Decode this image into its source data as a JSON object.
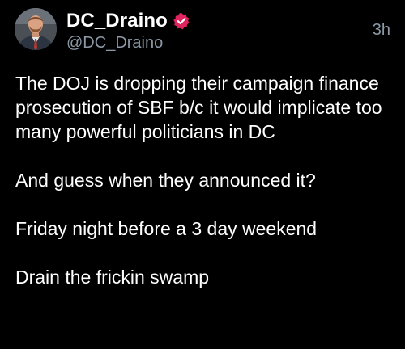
{
  "post": {
    "display_name": "DC_Draino",
    "handle": "@DC_Draino",
    "timestamp": "3h",
    "verified_color": "#e0245e",
    "paragraphs": [
      "The DOJ is dropping their campaign finance prosecution of SBF b/c it would implicate too many powerful politicians in DC",
      "And guess when they announced it?",
      "Friday night before a 3 day weekend",
      "Drain the frickin swamp"
    ]
  },
  "icons": {
    "avatar": "profile-photo",
    "verified": "verified-badge-icon"
  }
}
